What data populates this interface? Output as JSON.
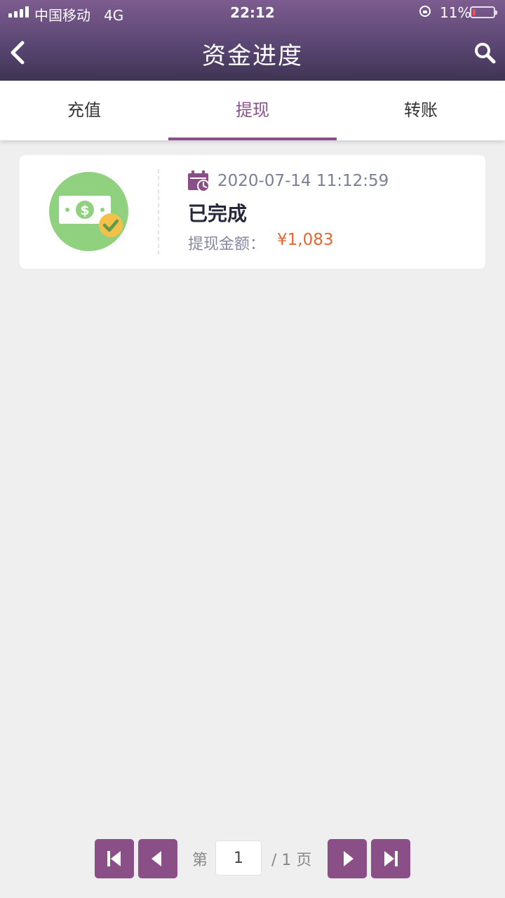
{
  "status_bar": {
    "carrier": "中国移动",
    "network": "4G",
    "time": "22:12",
    "battery": "11%",
    "icons": [
      "signal-icon",
      "rotation-lock-icon",
      "battery-icon"
    ]
  },
  "header": {
    "title": "资金进度",
    "back_icon": "chevron-left-icon",
    "search_icon": "search-icon"
  },
  "tabs": [
    {
      "label": "充值",
      "active": false
    },
    {
      "label": "提现",
      "active": true
    },
    {
      "label": "转账",
      "active": false
    }
  ],
  "records": [
    {
      "icon": "money-check-icon",
      "date_icon": "calendar-clock-icon",
      "datetime": "2020-07-14 11:12:59",
      "status": "已完成",
      "amount_label": "提现金额：",
      "amount": "¥1,083"
    }
  ],
  "pagination": {
    "prefix": "第",
    "current_page": "1",
    "suffix": "/ 1 页",
    "buttons": [
      "first-page-icon",
      "prev-page-icon",
      "next-page-icon",
      "last-page-icon"
    ]
  },
  "colors": {
    "accent": "#8a4f87",
    "header_top": "#7d5c8f",
    "header_bottom": "#3f3554",
    "amount": "#e8652e",
    "icon_green": "#8fd17f",
    "icon_check": "#f3c04a"
  }
}
